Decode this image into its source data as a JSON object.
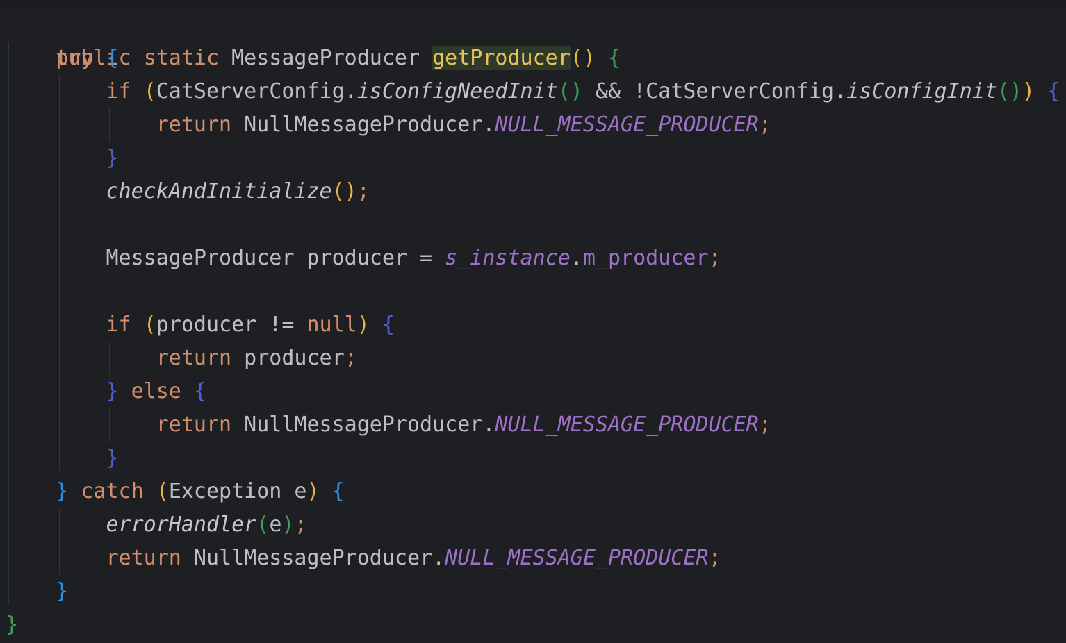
{
  "editor": {
    "language": "java",
    "theme_colors": {
      "background": "#1e1f22",
      "keyword": "#cf8e6d",
      "function_decl": "#e8c05c",
      "static_field": "#9e71c9",
      "text": "#bcbec4",
      "brace_level_1": "#3f9f56",
      "brace_level_2": "#2d8fe0",
      "brace_level_3": "#4f5fd0",
      "paren": "#e8b63d"
    },
    "lines": [
      {
        "t": [
          "public",
          " ",
          "static",
          " MessageProducer ",
          "getProducer",
          "()",
          " ",
          "{"
        ]
      },
      {
        "t": [
          "try",
          " ",
          "{"
        ]
      },
      {
        "t": [
          "if",
          " ",
          "(",
          "CatServerConfig.",
          "isConfigNeedInit",
          "()",
          " && !CatServerConfig.",
          "isConfigInit",
          "()",
          ")",
          " ",
          "{"
        ]
      },
      {
        "t": [
          "return",
          " NullMessageProducer.",
          "NULL_MESSAGE_PRODUCER",
          ";"
        ]
      },
      {
        "t": [
          "}"
        ]
      },
      {
        "t": [
          "checkAndInitialize",
          "()",
          ";"
        ]
      },
      {
        "t": []
      },
      {
        "t": [
          "MessageProducer producer = ",
          "s_instance",
          ".",
          "m_producer",
          ";"
        ]
      },
      {
        "t": []
      },
      {
        "t": [
          "if",
          " ",
          "(",
          "producer != ",
          "null",
          ")",
          " ",
          "{"
        ]
      },
      {
        "t": [
          "return",
          " producer",
          ";"
        ]
      },
      {
        "t": [
          "}",
          " ",
          "else",
          " ",
          "{"
        ]
      },
      {
        "t": [
          "return",
          " NullMessageProducer.",
          "NULL_MESSAGE_PRODUCER",
          ";"
        ]
      },
      {
        "t": [
          "}"
        ]
      },
      {
        "t": [
          "}",
          " ",
          "catch",
          " ",
          "(",
          "Exception e",
          ")",
          " ",
          "{"
        ]
      },
      {
        "t": [
          "errorHandler",
          "(",
          "e",
          ")",
          ";"
        ]
      },
      {
        "t": [
          "return",
          " NullMessageProducer.",
          "NULL_MESSAGE_PRODUCER",
          ";"
        ]
      },
      {
        "t": [
          "}"
        ]
      },
      {
        "t": [
          "}"
        ]
      }
    ]
  }
}
